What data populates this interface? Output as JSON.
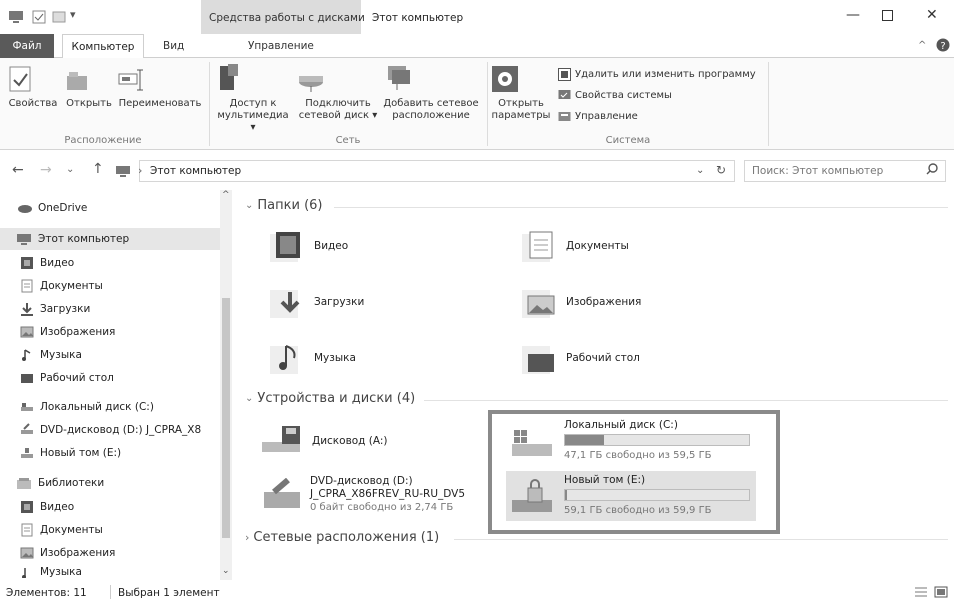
{
  "title": "Этот компьютер",
  "context_tab_group": "Средства работы с дисками",
  "tabs": {
    "file": "Файл",
    "computer": "Компьютер",
    "view": "Вид",
    "manage": "Управление"
  },
  "ribbon": {
    "location": {
      "label": "Расположение",
      "buttons": [
        "Свойства",
        "Открыть",
        "Переименовать"
      ]
    },
    "network": {
      "label": "Сеть",
      "media_l1": "Доступ к",
      "media_l2": "мультимедиа ▾",
      "map_l1": "Подключить",
      "map_l2": "сетевой диск ▾",
      "add_l1": "Добавить сетевое",
      "add_l2": "расположение"
    },
    "system": {
      "label": "Система",
      "open_l1": "Открыть",
      "open_l2": "параметры",
      "uninstall": "Удалить или изменить программу",
      "props": "Свойства системы",
      "manage": "Управление"
    }
  },
  "address": {
    "path": "Этот компьютер",
    "search_placeholder": "Поиск: Этот компьютер"
  },
  "nav": {
    "onedrive": "OneDrive",
    "this_pc": "Этот компьютер",
    "video": "Видео",
    "documents": "Документы",
    "downloads": "Загрузки",
    "pictures": "Изображения",
    "music": "Музыка",
    "desktop": "Рабочий стол",
    "local_c": "Локальный диск (C:)",
    "dvd_d": "DVD-дисковод (D:) J_CPRA_X8",
    "new_e": "Новый том (E:)",
    "libraries": "Библиотеки",
    "lib_video": "Видео",
    "lib_documents": "Документы",
    "lib_pictures": "Изображения",
    "lib_music": "Музыка"
  },
  "sections": {
    "folders": "Папки (6)",
    "devices": "Устройства и диски (4)",
    "network": "Сетевые расположения (1)"
  },
  "folders": {
    "video": "Видео",
    "documents": "Документы",
    "downloads": "Загрузки",
    "pictures": "Изображения",
    "music": "Музыка",
    "desktop": "Рабочий стол"
  },
  "devices": {
    "floppy": "Дисковод (A:)",
    "dvd_l1": "DVD-дисковод (D:)",
    "dvd_l2": "J_CPRA_X86FREV_RU-RU_DV5",
    "dvd_free": "0 байт свободно из 2,74 ГБ",
    "c_name": "Локальный диск (C:)",
    "c_free": "47,1 ГБ свободно из 59,5 ГБ",
    "c_used_fraction": 0.21,
    "e_name": "Новый том (E:)",
    "e_free": "59,1 ГБ свободно из 59,9 ГБ",
    "e_used_fraction": 0.013
  },
  "status": {
    "count": "Элементов: 11",
    "selected": "Выбран 1 элемент"
  }
}
